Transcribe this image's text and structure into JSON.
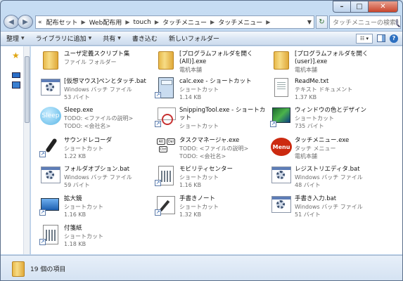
{
  "window": {
    "caption_buttons": {
      "minimize": "–",
      "maximize": "□",
      "close": "✕"
    }
  },
  "address": {
    "prefix": "«",
    "crumbs": [
      "配布セット",
      "Web配布用",
      "touch",
      "タッチメニュー",
      "タッチメニュー"
    ],
    "search_placeholder": "タッチメニューの検索"
  },
  "toolbar": {
    "organize": "整理",
    "add_to_library": "ライブラリに追加",
    "share": "共有",
    "burn": "書き込む",
    "new_folder": "新しいフォルダー"
  },
  "items": [
    {
      "name": "ユーザ定義スクリプト集",
      "d1": "ファイル フォルダー",
      "d2": "",
      "icon": "folder-icon"
    },
    {
      "name": "[プログラムフォルダを開く",
      "d1": "(All)].exe",
      "d2": "電机本舗",
      "icon": "folder-icon"
    },
    {
      "name": "[プログラムフォルダを開く",
      "d1": "(user)].exe",
      "d2": "電机本舗",
      "icon": "folder-icon"
    },
    {
      "name": "[仮想マウス]ペンとタッチ.bat",
      "d1": "Windows バッチ ファイル",
      "d2": "53 バイト",
      "icon": "batch-file-icon"
    },
    {
      "name": "calc.exe - ショートカット",
      "d1": "ショートカット",
      "d2": "1.14 KB",
      "icon": "calculator-icon"
    },
    {
      "name": "ReadMe.txt",
      "d1": "テキスト ドキュメント",
      "d2": "1.37 KB",
      "icon": "text-document-icon"
    },
    {
      "name": "Sleep.exe",
      "d1": "TODO: <ファイルの説明>",
      "d2": "TODO: <会社名>",
      "icon": "sleep-icon"
    },
    {
      "name": "SnippingTool.exe - ショートカ",
      "d1": "ット",
      "d2": "ショートカット",
      "icon": "snipping-tool-icon"
    },
    {
      "name": "ウィンドウの色とデザイン",
      "d1": "ショートカット",
      "d2": "735 バイト",
      "icon": "window-color-icon"
    },
    {
      "name": "サウンドレコーダ",
      "d1": "ショートカット",
      "d2": "1.22 KB",
      "icon": "microphone-icon"
    },
    {
      "name": "タスクマネージャ.exe",
      "d1": "TODO: <ファイルの説明>",
      "d2": "TODO: <会社名>",
      "icon": "task-manager-icon"
    },
    {
      "name": "タッチメニュー.exe",
      "d1": "タッチ メニュー",
      "d2": "電机本舗",
      "icon": "menu-icon"
    },
    {
      "name": "フォルダオプション.bat",
      "d1": "Windows バッチ ファイル",
      "d2": "59 バイト",
      "icon": "batch-file-icon"
    },
    {
      "name": "モビリティセンター",
      "d1": "ショートカット",
      "d2": "1.16 KB",
      "icon": "calendar-icon"
    },
    {
      "name": "レジストリエディタ.bat",
      "d1": "Windows バッチ ファイル",
      "d2": "48 バイト",
      "icon": "batch-file-icon"
    },
    {
      "name": "拡大鏡",
      "d1": "ショートカット",
      "d2": "1.16 KB",
      "icon": "magnifier-icon"
    },
    {
      "name": "手書きノート",
      "d1": "ショートカット",
      "d2": "1.32 KB",
      "icon": "pen-note-icon"
    },
    {
      "name": "手書き入力.bat",
      "d1": "Windows バッチ ファイル",
      "d2": "51 バイト",
      "icon": "batch-file-icon"
    },
    {
      "name": "付箋紙",
      "d1": "ショートカット",
      "d2": "1.18 KB",
      "icon": "calendar-icon"
    }
  ],
  "status": {
    "text": "19 個の項目"
  }
}
